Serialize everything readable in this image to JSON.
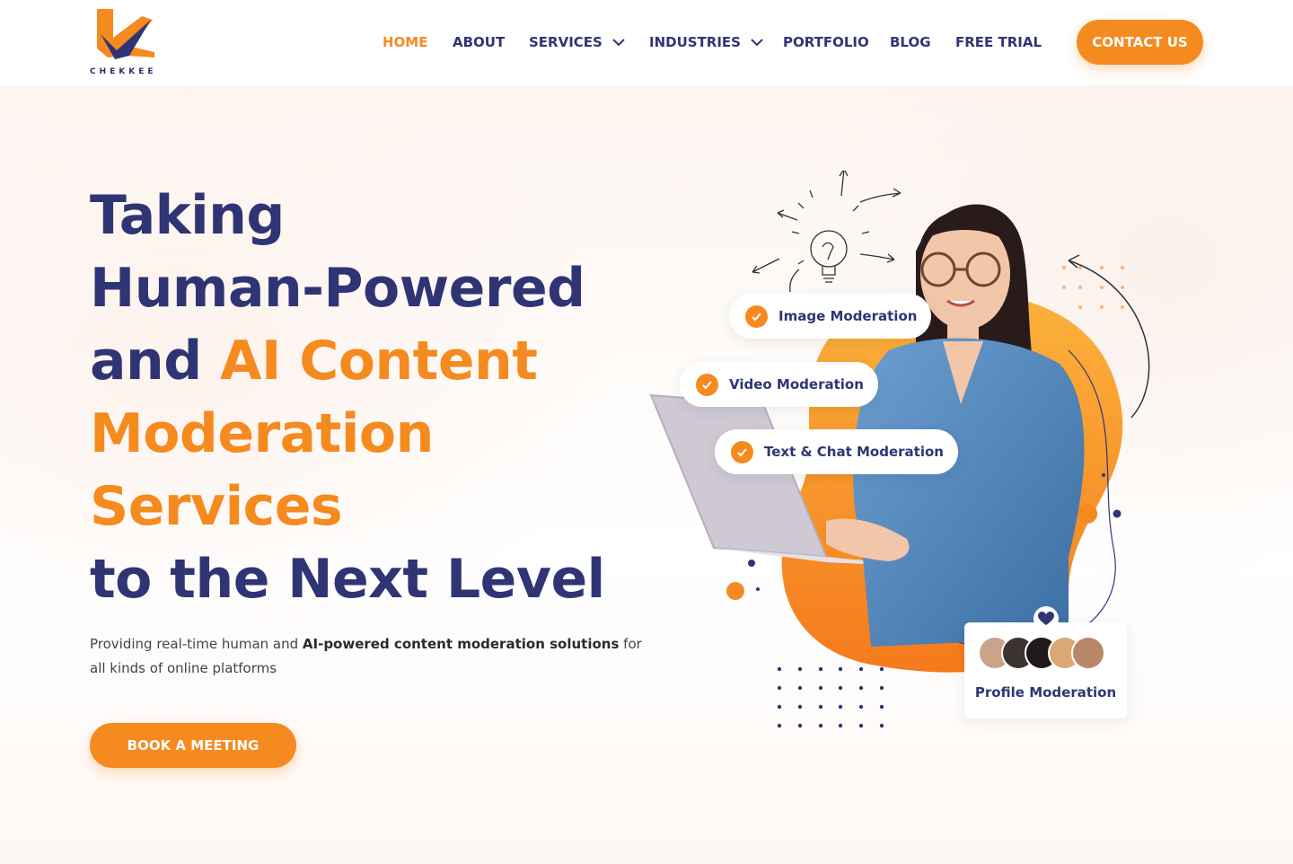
{
  "brand": {
    "name": "CHEKKEE",
    "colors": {
      "primary": "#2f3574",
      "accent": "#f58a1f"
    }
  },
  "nav": {
    "items": [
      {
        "label": "HOME",
        "active": true
      },
      {
        "label": "ABOUT"
      },
      {
        "label": "SERVICES",
        "dropdown": true
      },
      {
        "label": "INDUSTRIES",
        "dropdown": true
      },
      {
        "label": "PORTFOLIO"
      },
      {
        "label": "BLOG"
      },
      {
        "label": "FREE TRIAL"
      }
    ],
    "contact_label": "CONTACT US"
  },
  "hero": {
    "line1": "Taking",
    "line2": "Human-Powered",
    "line3_plain": "and ",
    "line3_accent": "AI Content",
    "line4": "Moderation",
    "line5": "Services",
    "line6": "to the Next Level",
    "sub_part1": "Providing real-time human and ",
    "sub_bold": "AI-powered content moderation solutions",
    "sub_part2": " for all kinds of online platforms",
    "cta_label": "BOOK A MEETING"
  },
  "features": {
    "image": "Image Moderation",
    "video": "Video Moderation",
    "text": "Text & Chat Moderation",
    "profile": "Profile Moderation"
  },
  "icons": [
    "check-icon",
    "chevron-down-icon",
    "heart-icon",
    "lightbulb-icon",
    "arrow-icon"
  ]
}
